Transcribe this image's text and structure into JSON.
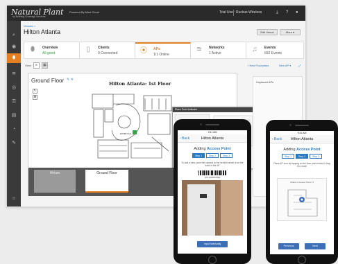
{
  "app": {
    "logo": "Natural Plant",
    "logo_sub": "by Building Coverage Services",
    "powered_by": "Powered By Mind Cloud",
    "trial_user": "Trial User",
    "account": "Ruckus Wireless",
    "topbar_icons": [
      "download-icon",
      "help-icon",
      "user-icon"
    ]
  },
  "sidebar": {
    "icons": [
      "search-icon",
      "dashboard-icon",
      "location-pin-icon",
      "wifi-icon",
      "ap-icon",
      "network-icon",
      "report-icon",
      "settings-icon",
      "chat-icon"
    ],
    "active_index": 2
  },
  "header": {
    "breadcrumb": "Venues >",
    "venue_name": "Hilton Atlanta",
    "edit_venue": "Edit Venue",
    "more": "More ▾"
  },
  "tabs": [
    {
      "icon": "location-pin-icon",
      "label": "Overview",
      "value": "All good",
      "value_color": "#3a9d3a"
    },
    {
      "icon": "phone-icon",
      "label": "Clients",
      "value": "0 Connected",
      "value_color": "#555555"
    },
    {
      "icon": "ap-icon",
      "label": "APs",
      "value": "1/1 Online",
      "value_color": "#555555"
    },
    {
      "icon": "wifi-icon",
      "label": "Networks",
      "value": "1 Active",
      "value_color": "#555555"
    },
    {
      "icon": "bell-icon",
      "label": "Events",
      "value": "692 Events",
      "value_color": "#555555"
    }
  ],
  "view_row": {
    "view_label": "View",
    "new_floorplans": "+ New Floorplans",
    "new_ap": "New AP ▾"
  },
  "map": {
    "floor_title": "Ground Floor",
    "map_title": "Hilton Atlanta: 1st Floor",
    "modal_title": "Place Point Indicator",
    "thumbnails": [
      "Atrium",
      "Ground Floor"
    ]
  },
  "unplaced": {
    "label": "Unplaced APs"
  },
  "phone1": {
    "time": "9:41 AM",
    "back": "‹ Back",
    "title": "Hilton Atlanta",
    "adding_prefix": "Adding ",
    "adding_highlight": "Access Point",
    "steps": [
      "Step 1",
      "Step 2",
      "Step 3"
    ],
    "active_step": 0,
    "instruction": "To add a new, point the camera to the serial # which is on the back of the AP",
    "serial": "S/N 1234567890",
    "button": "Input Manually"
  },
  "phone2": {
    "time": "9:41 AM",
    "back": "‹ Back",
    "title": "Hilton Atlanta",
    "adding_prefix": "Adding ",
    "adding_highlight": "Access Point",
    "steps": [
      "Step 1",
      "Step 2",
      "Step 3"
    ],
    "active_step": 1,
    "instruction": "Place AP Icon by tapping on the floor plan below & drag it to move",
    "map_label": "Where is Access Point 1?",
    "prev": "Previous",
    "next": "Next"
  },
  "colors": {
    "accent": "#e67e22",
    "link": "#2a7ac0",
    "phone_button": "#3d6fb6",
    "topbar": "#2a2a2a",
    "sidebar": "#3a3a3a"
  }
}
